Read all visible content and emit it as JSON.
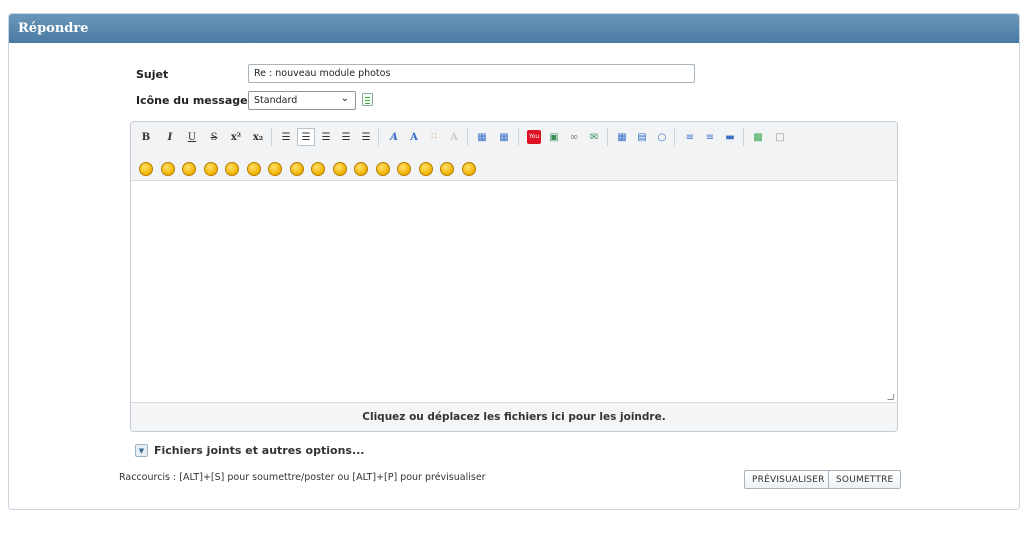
{
  "panel": {
    "title": "Répondre"
  },
  "form": {
    "subject_label": "Sujet",
    "subject_value": "Re : nouveau module photos",
    "icon_label": "Icône du message",
    "icon_selected": "Standard"
  },
  "toolbar": {
    "format_buttons": [
      "B",
      "I",
      "U",
      "S",
      "x²",
      "x₂"
    ],
    "icons": [
      "bold-icon",
      "italic-icon",
      "underline-icon",
      "strike-icon",
      "superscript-icon",
      "subscript-icon",
      "indent-icon",
      "align-left-icon",
      "align-center-icon",
      "align-right-icon",
      "justify-icon",
      "font-icon",
      "highlight-icon",
      "color-icon",
      "clear-format-icon",
      "float-left-icon",
      "float-right-icon",
      "youtube-icon",
      "image-icon",
      "link-icon",
      "email-icon",
      "table-icon",
      "quote-icon",
      "bubble-icon",
      "list-icon",
      "ordered-list-icon",
      "hr-icon",
      "more-icon",
      "source-icon"
    ]
  },
  "smileys_count": 16,
  "dropzone_text": "Cliquez ou déplacez les fichiers ici pour les joindre.",
  "attachments": {
    "label": "Fichiers joints et autres options..."
  },
  "shortcuts": "Raccourcis : [ALT]+[S] pour soumettre/poster ou [ALT]+[P] pour prévisualiser",
  "buttons": {
    "preview": "PRÉVISUALISER",
    "submit": "SOUMETTRE"
  },
  "colors": {
    "header_top": "#6a98bb",
    "header_bottom": "#4a7aa2"
  }
}
